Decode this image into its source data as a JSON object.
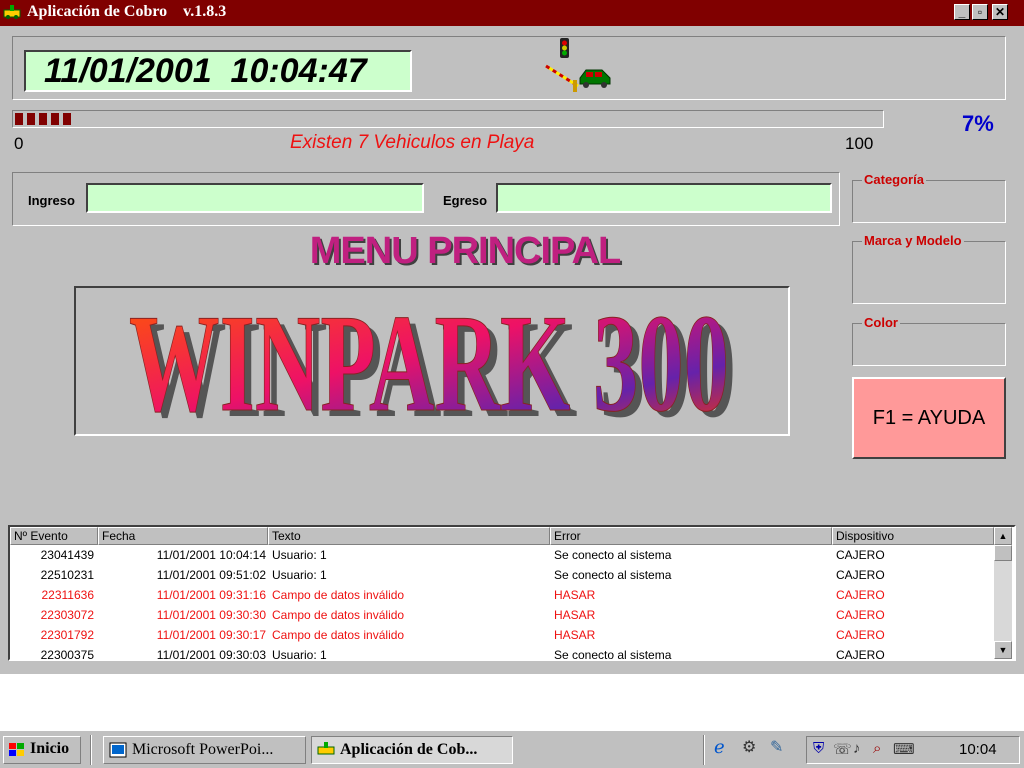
{
  "window": {
    "title": "Aplicación de Cobro    v.1.8.3",
    "minimize_label": "_",
    "restore_label": "▫",
    "close_label": "✕"
  },
  "clock": {
    "value": "11/01/2001  10:04:47"
  },
  "progress": {
    "percent_text": "7%",
    "value_fraction": 0.07,
    "min_label": "0",
    "max_label": "100",
    "message": "Existen 7 Vehiculos en Playa"
  },
  "io": {
    "ingreso_label": "Ingreso",
    "egreso_label": "Egreso",
    "ingreso_value": "",
    "egreso_value": ""
  },
  "menu": {
    "title": "MENU PRINCIPAL"
  },
  "logo": {
    "text": "WINPARK 300"
  },
  "groups": {
    "categoria": "Categoría",
    "marca_modelo": "Marca y Modelo",
    "color": "Color"
  },
  "help": {
    "label": "F1 = AYUDA"
  },
  "log": {
    "columns": [
      "Nº Evento",
      "Fecha",
      "Texto",
      "Error",
      "Dispositivo"
    ],
    "rows": [
      {
        "id": "23041439",
        "date": "11/01/2001 10:04:14",
        "text": "Usuario: 1",
        "error": "Se conecto al sistema",
        "device": "CAJERO",
        "is_error": false
      },
      {
        "id": "22510231",
        "date": "11/01/2001 09:51:02",
        "text": "Usuario: 1",
        "error": "Se conecto al sistema",
        "device": "CAJERO",
        "is_error": false
      },
      {
        "id": "22311636",
        "date": "11/01/2001 09:31:16",
        "text": "Campo de datos inválido",
        "error": "HASAR",
        "device": "CAJERO",
        "is_error": true
      },
      {
        "id": "22303072",
        "date": "11/01/2001 09:30:30",
        "text": "Campo de datos inválido",
        "error": "HASAR",
        "device": "CAJERO",
        "is_error": true
      },
      {
        "id": "22301792",
        "date": "11/01/2001 09:30:17",
        "text": "Campo de datos inválido",
        "error": "HASAR",
        "device": "CAJERO",
        "is_error": true
      },
      {
        "id": "22300375",
        "date": "11/01/2001 09:30:03",
        "text": "Usuario: 1",
        "error": "Se conecto al sistema",
        "device": "CAJERO",
        "is_error": false
      }
    ]
  },
  "taskbar": {
    "start_label": "Inicio",
    "tasks": [
      {
        "label": "Microsoft PowerPoi...",
        "active": false
      },
      {
        "label": "Aplicación de Cob...",
        "active": true
      }
    ],
    "time": "10:04"
  },
  "colors": {
    "titlebar": "#800000",
    "display_green": "#ccffcc",
    "error_red": "#ee1111",
    "help_pink": "#ff9999",
    "percent_blue": "#0000cc"
  },
  "icons": {
    "app": "traffic-barrier-icon",
    "start": "windows-flag-icon",
    "powerpoint": "powerpoint-icon",
    "tray": [
      "ie-icon",
      "network-icon",
      "edit-icon",
      "antivirus-icon",
      "connection-icon",
      "volume-icon",
      "search-icon",
      "keyboard-icon"
    ]
  }
}
